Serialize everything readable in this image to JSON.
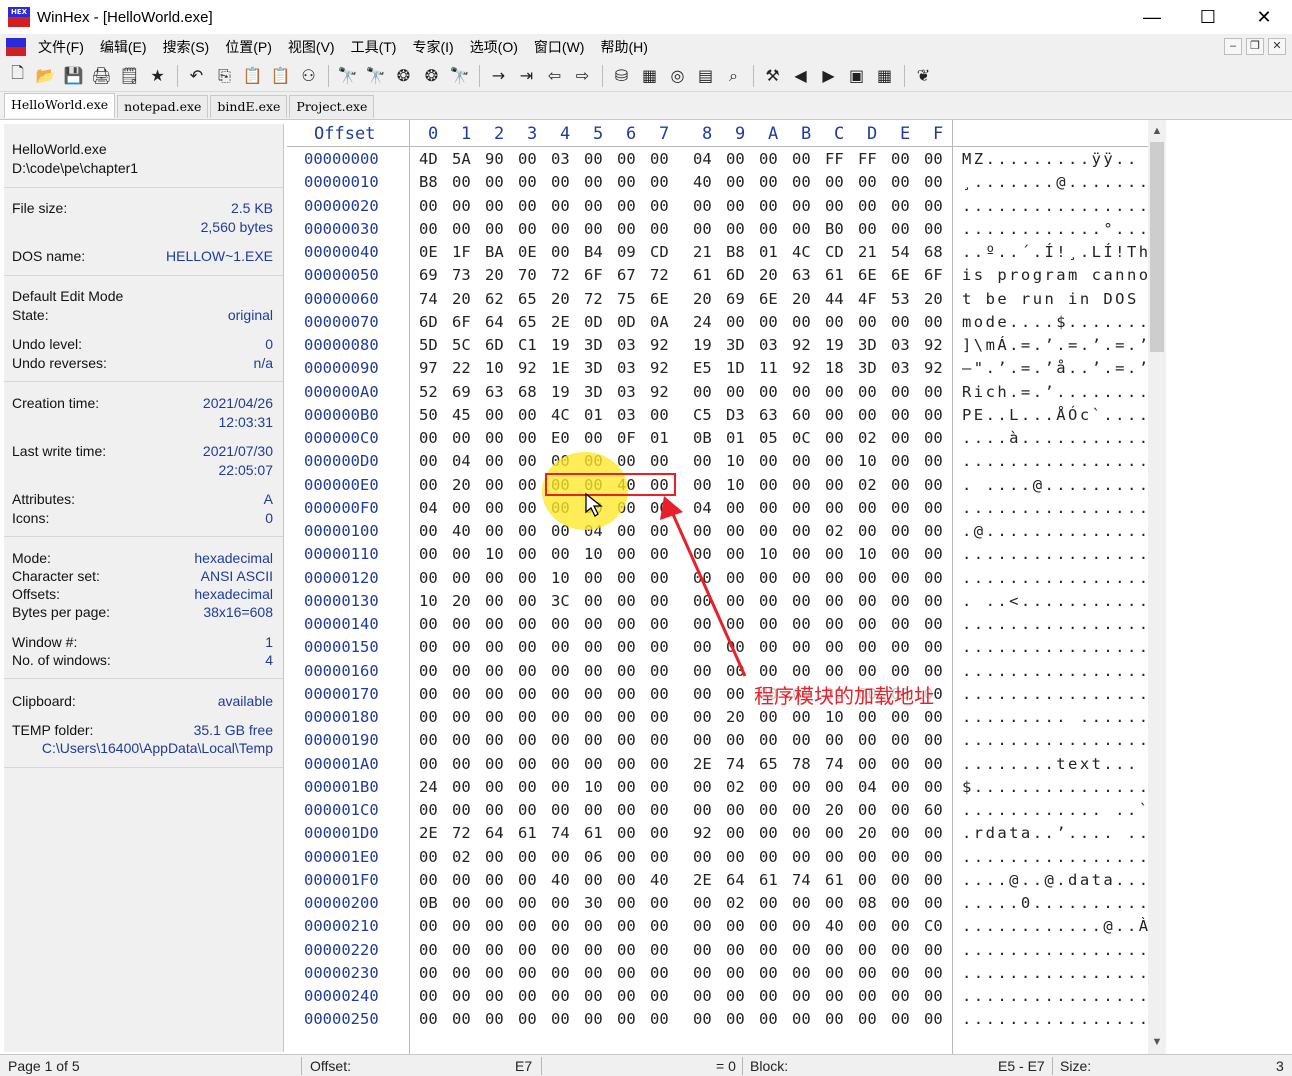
{
  "window": {
    "title": "WinHex - [HelloWorld.exe]",
    "app_icon_text": "HEX",
    "controls": [
      "—",
      "☐",
      "✕"
    ]
  },
  "menu": {
    "items": [
      "文件(F)",
      "编辑(E)",
      "搜索(S)",
      "位置(P)",
      "视图(V)",
      "工具(T)",
      "专家(I)",
      "选项(O)",
      "窗口(W)",
      "帮助(H)"
    ],
    "mdi_controls": [
      "–",
      "❐",
      "✕"
    ]
  },
  "toolbar": {
    "buttons": [
      {
        "name": "new-icon",
        "glyph": "🗋"
      },
      {
        "name": "open-icon",
        "glyph": "📂"
      },
      {
        "name": "save-icon",
        "glyph": "💾"
      },
      {
        "name": "print-icon",
        "glyph": "🖨"
      },
      {
        "name": "properties-icon",
        "glyph": "🗒"
      },
      {
        "name": "run-icon",
        "glyph": "★"
      },
      {
        "sep": true
      },
      {
        "name": "undo-icon",
        "glyph": "↶"
      },
      {
        "name": "copy-icon",
        "glyph": "⎘"
      },
      {
        "name": "paste-icon",
        "glyph": "📋"
      },
      {
        "name": "paste-write-icon",
        "glyph": "📋"
      },
      {
        "name": "convert-icon",
        "glyph": "⚇"
      },
      {
        "sep": true
      },
      {
        "name": "find-text-icon",
        "glyph": "🔭"
      },
      {
        "name": "find-hex-icon",
        "glyph": "🔭"
      },
      {
        "name": "replace-text-icon",
        "glyph": "❂"
      },
      {
        "name": "replace-hex-icon",
        "glyph": "❂"
      },
      {
        "name": "find-next-icon",
        "glyph": "🔭"
      },
      {
        "sep": true
      },
      {
        "name": "goto-offset-icon",
        "glyph": "→"
      },
      {
        "name": "goto-page-icon",
        "glyph": "⇥"
      },
      {
        "name": "back-icon",
        "glyph": "⇦"
      },
      {
        "name": "forward-icon",
        "glyph": "⇨"
      },
      {
        "sep": true
      },
      {
        "name": "open-disk-icon",
        "glyph": "⛁"
      },
      {
        "name": "open-ram-icon",
        "glyph": "▦"
      },
      {
        "name": "disk-tools-icon",
        "glyph": "◎"
      },
      {
        "name": "calculator-icon",
        "glyph": "▤"
      },
      {
        "name": "zoom-icon",
        "glyph": "⌕"
      },
      {
        "sep": true
      },
      {
        "name": "analyze-icon",
        "glyph": "⚒"
      },
      {
        "name": "prev-icon",
        "glyph": "◀"
      },
      {
        "name": "next-icon",
        "glyph": "▶"
      },
      {
        "name": "snapshot-icon",
        "glyph": "▣"
      },
      {
        "name": "table-icon",
        "glyph": "▦"
      },
      {
        "sep": true
      },
      {
        "name": "help-icon",
        "glyph": "❦"
      }
    ]
  },
  "tabs": [
    "HelloWorld.exe",
    "notepad.exe",
    "bindE.exe",
    "Project.exe"
  ],
  "info": {
    "file_name": "HelloWorld.exe",
    "file_path": "D:\\code\\pe\\chapter1",
    "file_size_label": "File size:",
    "file_size_kb": "2.5 KB",
    "file_size_bytes": "2,560 bytes",
    "dos_name_label": "DOS name:",
    "dos_name": "HELLOW~1.EXE",
    "edit_mode_label": "Default Edit Mode",
    "state_label": "State:",
    "state": "original",
    "undo_level_label": "Undo level:",
    "undo_level": "0",
    "undo_reverses_label": "Undo reverses:",
    "undo_reverses": "n/a",
    "creation_label": "Creation time:",
    "creation_date": "2021/04/26",
    "creation_time": "12:03:31",
    "write_label": "Last write time:",
    "write_date": "2021/07/30",
    "write_time": "22:05:07",
    "attributes_label": "Attributes:",
    "attributes": "A",
    "icons_label": "Icons:",
    "icons": "0",
    "mode_label": "Mode:",
    "mode": "hexadecimal",
    "charset_label": "Character set:",
    "charset": "ANSI ASCII",
    "offsets_label": "Offsets:",
    "offsets": "hexadecimal",
    "bpp_label": "Bytes per page:",
    "bpp": "38x16=608",
    "window_label": "Window #:",
    "window": "1",
    "nwin_label": "No. of windows:",
    "nwin": "4",
    "clipboard_label": "Clipboard:",
    "clipboard": "available",
    "temp_label": "TEMP folder:",
    "temp_free": "35.1 GB free",
    "temp_path": "C:\\Users\\16400\\AppData\\Local\\Temp"
  },
  "hex": {
    "offset_header": "Offset",
    "col_headers": [
      "0",
      "1",
      "2",
      "3",
      "4",
      "5",
      "6",
      "7",
      "8",
      "9",
      "A",
      "B",
      "C",
      "D",
      "E",
      "F"
    ],
    "rows": [
      {
        "o": "00000000",
        "b": "4D 5A 90 00 03 00 00 00 04 00 00 00 FF FF 00 00",
        "a": "MZ.........ÿÿ.."
      },
      {
        "o": "00000010",
        "b": "B8 00 00 00 00 00 00 00 40 00 00 00 00 00 00 00",
        "a": "¸.......@......."
      },
      {
        "o": "00000020",
        "b": "00 00 00 00 00 00 00 00 00 00 00 00 00 00 00 00",
        "a": "................"
      },
      {
        "o": "00000030",
        "b": "00 00 00 00 00 00 00 00 00 00 00 00 B0 00 00 00",
        "a": "............°..."
      },
      {
        "o": "00000040",
        "b": "0E 1F BA 0E 00 B4 09 CD 21 B8 01 4C CD 21 54 68",
        "a": "..º..´.Í!¸.LÍ!Th"
      },
      {
        "o": "00000050",
        "b": "69 73 20 70 72 6F 67 72 61 6D 20 63 61 6E 6E 6F",
        "a": "is program canno"
      },
      {
        "o": "00000060",
        "b": "74 20 62 65 20 72 75 6E 20 69 6E 20 44 4F 53 20",
        "a": "t be run in DOS "
      },
      {
        "o": "00000070",
        "b": "6D 6F 64 65 2E 0D 0D 0A 24 00 00 00 00 00 00 00",
        "a": "mode....$......."
      },
      {
        "o": "00000080",
        "b": "5D 5C 6D C1 19 3D 03 92 19 3D 03 92 19 3D 03 92",
        "a": "]\\mÁ.=.’.=.’.=.’"
      },
      {
        "o": "00000090",
        "b": "97 22 10 92 1E 3D 03 92 E5 1D 11 92 18 3D 03 92",
        "a": "—\".’.=.’å..’.=.’"
      },
      {
        "o": "000000A0",
        "b": "52 69 63 68 19 3D 03 92 00 00 00 00 00 00 00 00",
        "a": "Rich.=.’........"
      },
      {
        "o": "000000B0",
        "b": "50 45 00 00 4C 01 03 00 C5 D3 63 60 00 00 00 00",
        "a": "PE..L...ÅÓc`...."
      },
      {
        "o": "000000C0",
        "b": "00 00 00 00 E0 00 0F 01 0B 01 05 0C 00 02 00 00",
        "a": "....à..........."
      },
      {
        "o": "000000D0",
        "b": "00 04 00 00 00 00 00 00 00 10 00 00 00 10 00 00",
        "a": "................"
      },
      {
        "o": "000000E0",
        "b": "00 20 00 00 00 00 40 00 00 10 00 00 00 02 00 00",
        "a": ". ....@........."
      },
      {
        "o": "000000F0",
        "b": "04 00 00 00 00 00 00 00 04 00 00 00 00 00 00 00",
        "a": "................"
      },
      {
        "o": "00000100",
        "b": "00 40 00 00 00 04 00 00 00 00 00 00 02 00 00 00",
        "a": ".@.............."
      },
      {
        "o": "00000110",
        "b": "00 00 10 00 00 10 00 00 00 00 10 00 00 10 00 00",
        "a": "................"
      },
      {
        "o": "00000120",
        "b": "00 00 00 00 10 00 00 00 00 00 00 00 00 00 00 00",
        "a": "................"
      },
      {
        "o": "00000130",
        "b": "10 20 00 00 3C 00 00 00 00 00 00 00 00 00 00 00",
        "a": ". ..<..........."
      },
      {
        "o": "00000140",
        "b": "00 00 00 00 00 00 00 00 00 00 00 00 00 00 00 00",
        "a": "................"
      },
      {
        "o": "00000150",
        "b": "00 00 00 00 00 00 00 00 00 00 00 00 00 00 00 00",
        "a": "................"
      },
      {
        "o": "00000160",
        "b": "00 00 00 00 00 00 00 00 00 00 00 00 00 00 00 00",
        "a": "................"
      },
      {
        "o": "00000170",
        "b": "00 00 00 00 00 00 00 00 00 00 00 00 00 00 00 00",
        "a": "................"
      },
      {
        "o": "00000180",
        "b": "00 00 00 00 00 00 00 00 00 20 00 00 10 00 00 00",
        "a": "......... ......"
      },
      {
        "o": "00000190",
        "b": "00 00 00 00 00 00 00 00 00 00 00 00 00 00 00 00",
        "a": "................"
      },
      {
        "o": "000001A0",
        "b": "00 00 00 00 00 00 00 00 2E 74 65 78 74 00 00 00",
        "a": "........text..."
      },
      {
        "o": "000001B0",
        "b": "24 00 00 00 00 10 00 00 00 02 00 00 00 04 00 00",
        "a": "$..............."
      },
      {
        "o": "000001C0",
        "b": "00 00 00 00 00 00 00 00 00 00 00 00 20 00 00 60",
        "a": "............ ..`"
      },
      {
        "o": "000001D0",
        "b": "2E 72 64 61 74 61 00 00 92 00 00 00 00 20 00 00",
        "a": ".rdata..’.... .."
      },
      {
        "o": "000001E0",
        "b": "00 02 00 00 00 06 00 00 00 00 00 00 00 00 00 00",
        "a": "................"
      },
      {
        "o": "000001F0",
        "b": "00 00 00 00 40 00 00 40 2E 64 61 74 61 00 00 00",
        "a": "....@..@.data..."
      },
      {
        "o": "00000200",
        "b": "0B 00 00 00 00 30 00 00 00 02 00 00 00 08 00 00",
        "a": ".....0.........."
      },
      {
        "o": "00000210",
        "b": "00 00 00 00 00 00 00 00 00 00 00 00 40 00 00 C0",
        "a": "............@..À"
      },
      {
        "o": "00000220",
        "b": "00 00 00 00 00 00 00 00 00 00 00 00 00 00 00 00",
        "a": "................"
      },
      {
        "o": "00000230",
        "b": "00 00 00 00 00 00 00 00 00 00 00 00 00 00 00 00",
        "a": "................"
      },
      {
        "o": "00000240",
        "b": "00 00 00 00 00 00 00 00 00 00 00 00 00 00 00 00",
        "a": "................"
      },
      {
        "o": "00000250",
        "b": "00 00 00 00 00 00 00 00 00 00 00 00 00 00 00 00",
        "a": "................"
      }
    ]
  },
  "annotation": {
    "text": "程序模块的加载地址",
    "color": "#e8202a"
  },
  "status": {
    "page": "Page 1 of 5",
    "offset_label": "Offset:",
    "offset_value": "E7",
    "value": "= 0",
    "block_label": "Block:",
    "block_range": "E5 - E7",
    "size_label": "Size:",
    "size_value": "3"
  }
}
